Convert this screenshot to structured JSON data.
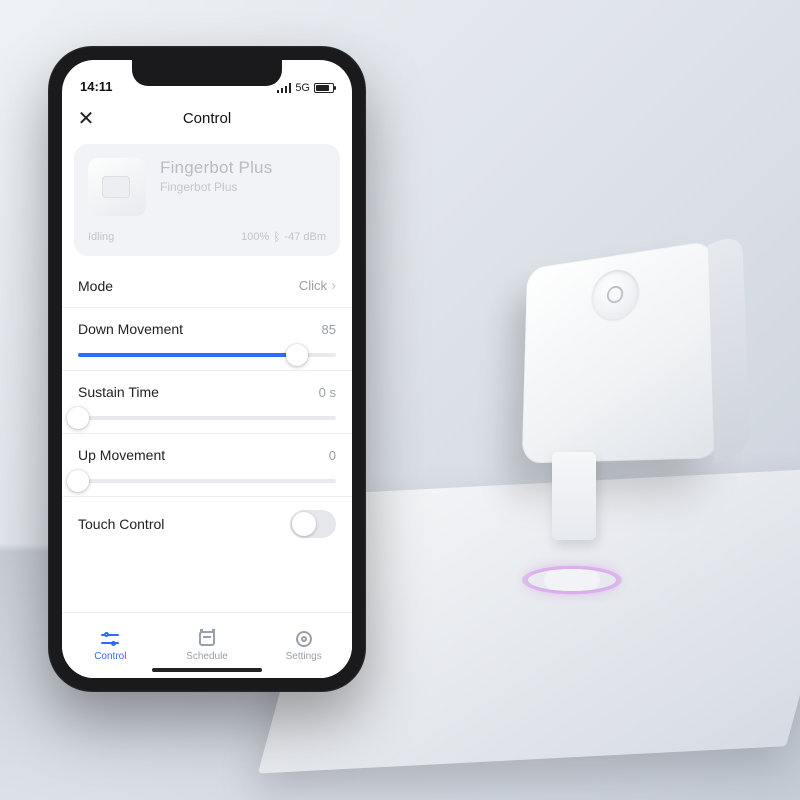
{
  "status": {
    "time": "14:11",
    "network": "5G"
  },
  "nav": {
    "title": "Control"
  },
  "device": {
    "name": "Fingerbot Plus",
    "model": "Fingerbot Plus",
    "state": "Idling",
    "battery_pct": "100%",
    "signal": "-47 dBm"
  },
  "settings": {
    "mode": {
      "label": "Mode",
      "value": "Click"
    },
    "down": {
      "label": "Down Movement",
      "value": "85",
      "percent": 85
    },
    "sustain": {
      "label": "Sustain Time",
      "value": "0 s",
      "percent": 0
    },
    "up": {
      "label": "Up Movement",
      "value": "0",
      "percent": 0
    },
    "touch": {
      "label": "Touch Control",
      "on": false
    }
  },
  "tabs": {
    "control": "Control",
    "schedule": "Schedule",
    "settings": "Settings"
  },
  "colors": {
    "accent": "#2f6bff"
  }
}
